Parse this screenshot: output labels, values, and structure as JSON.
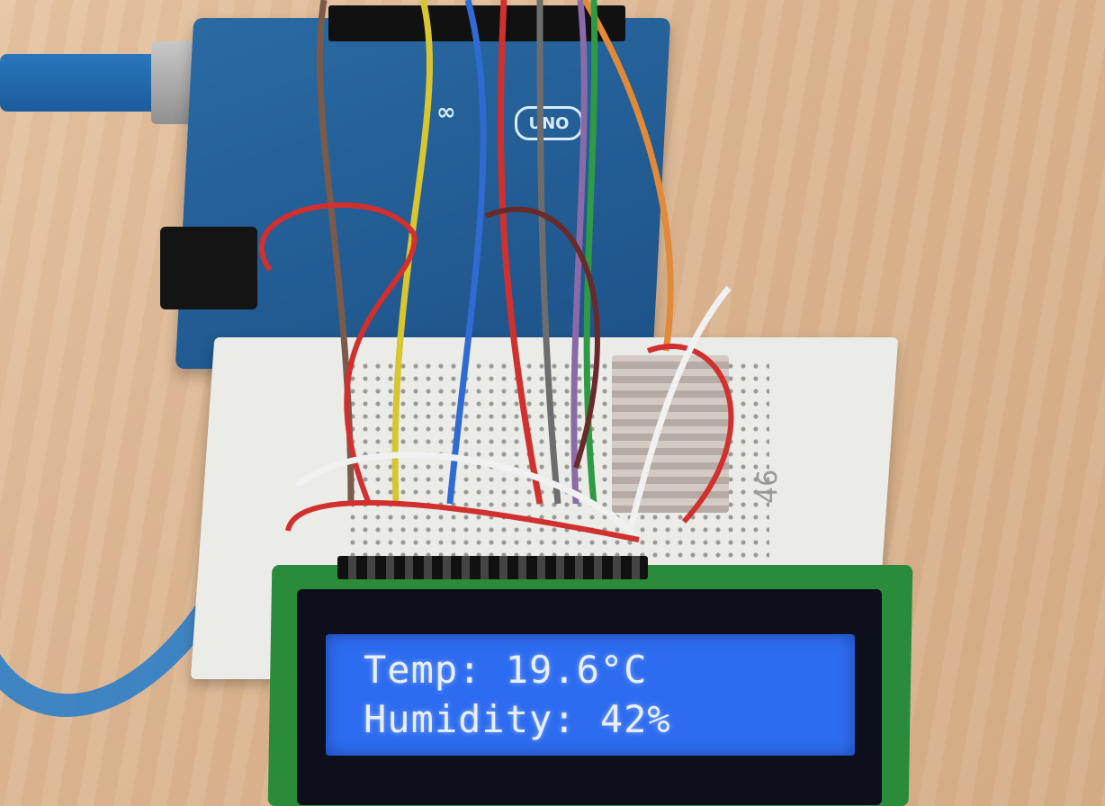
{
  "board": {
    "logo": "∞",
    "model": "UNO"
  },
  "breadboard": {
    "label": "46"
  },
  "lcd": {
    "line1": "Temp: 19.6°C",
    "line2": "Humidity: 42%"
  }
}
